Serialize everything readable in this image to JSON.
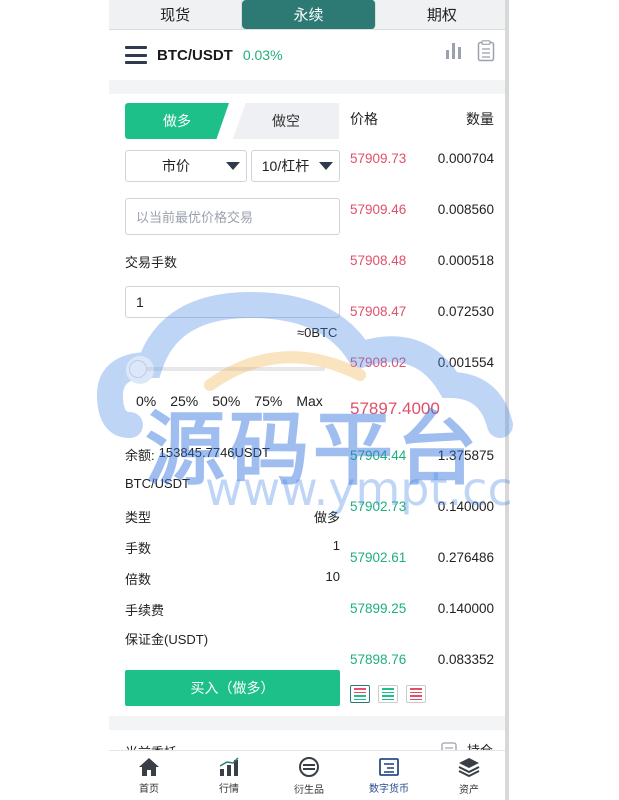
{
  "tabs": [
    "现货",
    "永续",
    "期权"
  ],
  "active_tab": 1,
  "header": {
    "pair": "BTC/USDT",
    "change": "0.03%"
  },
  "form": {
    "long_label": "做多",
    "short_label": "做空",
    "order_type": "市价",
    "leverage": "10/杠杆",
    "price_placeholder": "以当前最优价格交易",
    "fee_label": "交易手数",
    "quantity": "1",
    "approx": "≈0BTC",
    "percents": [
      "0%",
      "25%",
      "50%",
      "75%",
      "Max"
    ],
    "balance_label": "余额:",
    "balance_value": "153845.7746USDT",
    "pair_line": "BTC/USDT",
    "details": [
      {
        "k": "类型",
        "v": "做多"
      },
      {
        "k": "手数",
        "v": "1"
      },
      {
        "k": "倍数",
        "v": "10"
      },
      {
        "k": "手续费",
        "v": ""
      },
      {
        "k": "保证金(USDT)",
        "v": ""
      }
    ],
    "buy_label": "买入（做多）"
  },
  "orderbook": {
    "price_header": "价格",
    "qty_header": "数量",
    "asks": [
      {
        "price": "57909.73",
        "qty": "0.000704"
      },
      {
        "price": "57909.46",
        "qty": "0.008560"
      },
      {
        "price": "57908.48",
        "qty": "0.000518"
      },
      {
        "price": "57908.47",
        "qty": "0.072530"
      },
      {
        "price": "57908.02",
        "qty": "0.001554"
      }
    ],
    "mid": "57897.4000",
    "bids": [
      {
        "price": "57904.44",
        "qty": "1.375875"
      },
      {
        "price": "57902.73",
        "qty": "0.140000"
      },
      {
        "price": "57902.61",
        "qty": "0.276486"
      },
      {
        "price": "57899.25",
        "qty": "0.140000"
      },
      {
        "price": "57898.76",
        "qty": "0.083352"
      }
    ]
  },
  "below": {
    "left": "当前委托",
    "right": "持仓"
  },
  "nav": [
    {
      "label": "首页",
      "icon": "home-icon"
    },
    {
      "label": "行情",
      "icon": "chart-icon"
    },
    {
      "label": "衍生品",
      "icon": "derivatives-icon"
    },
    {
      "label": "数字货币",
      "icon": "crypto-icon"
    },
    {
      "label": "资产",
      "icon": "assets-icon"
    }
  ],
  "active_nav": 3,
  "watermark": {
    "text": "源码平台",
    "url": "www.ympt.cc"
  },
  "colors": {
    "green": "#1ec08a",
    "red": "#e0506a",
    "teal": "#2c7a73",
    "navy": "#2a4c8c"
  }
}
